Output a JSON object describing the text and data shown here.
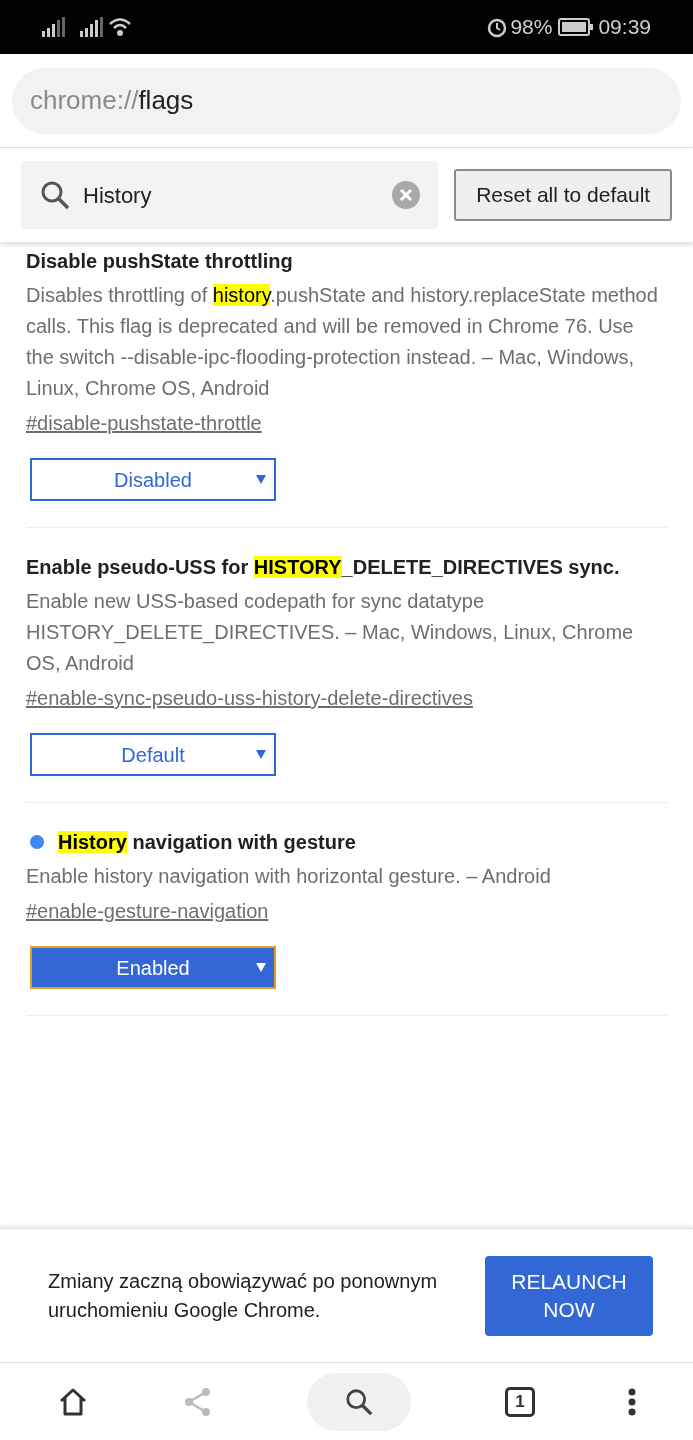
{
  "status_bar": {
    "battery": "98%",
    "time": "09:39"
  },
  "address_bar": {
    "scheme": "chrome://",
    "host": "flags"
  },
  "search": {
    "value": "History"
  },
  "reset_button": "Reset all to default",
  "flags": [
    {
      "modified": false,
      "title": [
        {
          "text": "Disable pushState throttling",
          "highlighted": false
        }
      ],
      "description": [
        {
          "text": "Disables throttling of ",
          "highlighted": false
        },
        {
          "text": "history",
          "highlighted": true
        },
        {
          "text": ".pushState and history.replaceState method calls. This flag is deprecated and will be removed in Chrome 76. Use the switch --disable-ipc-flooding-protection instead. – Mac, Windows, Linux, Chrome OS, Android",
          "highlighted": false
        }
      ],
      "link": "#disable-pushstate-throttle",
      "value": "Disabled",
      "active": false
    },
    {
      "modified": false,
      "title": [
        {
          "text": "Enable pseudo-USS for ",
          "highlighted": false
        },
        {
          "text": "HISTORY",
          "highlighted": true
        },
        {
          "text": "_DELETE_DIRECTIVES sync.",
          "highlighted": false
        }
      ],
      "description": [
        {
          "text": "Enable new USS-based codepath for sync datatype HISTORY_DELETE_DIRECTIVES. – Mac, Windows, Linux, Chrome OS, Android",
          "highlighted": false
        }
      ],
      "link": "#enable-sync-pseudo-uss-history-delete-directives",
      "value": "Default",
      "active": false
    },
    {
      "modified": true,
      "title": [
        {
          "text": "History",
          "highlighted": true
        },
        {
          "text": " navigation with gesture",
          "highlighted": false
        }
      ],
      "description": [
        {
          "text": "Enable history navigation with horizontal gesture. – Android",
          "highlighted": false
        }
      ],
      "link": "#enable-gesture-navigation",
      "value": "Enabled",
      "active": true
    }
  ],
  "relaunch": {
    "message": "Zmiany zaczną obowiązywać po ponownym uruchomieniu Google Chrome.",
    "button": "RELAUNCH NOW"
  },
  "toolbar": {
    "tab_count": "1"
  }
}
